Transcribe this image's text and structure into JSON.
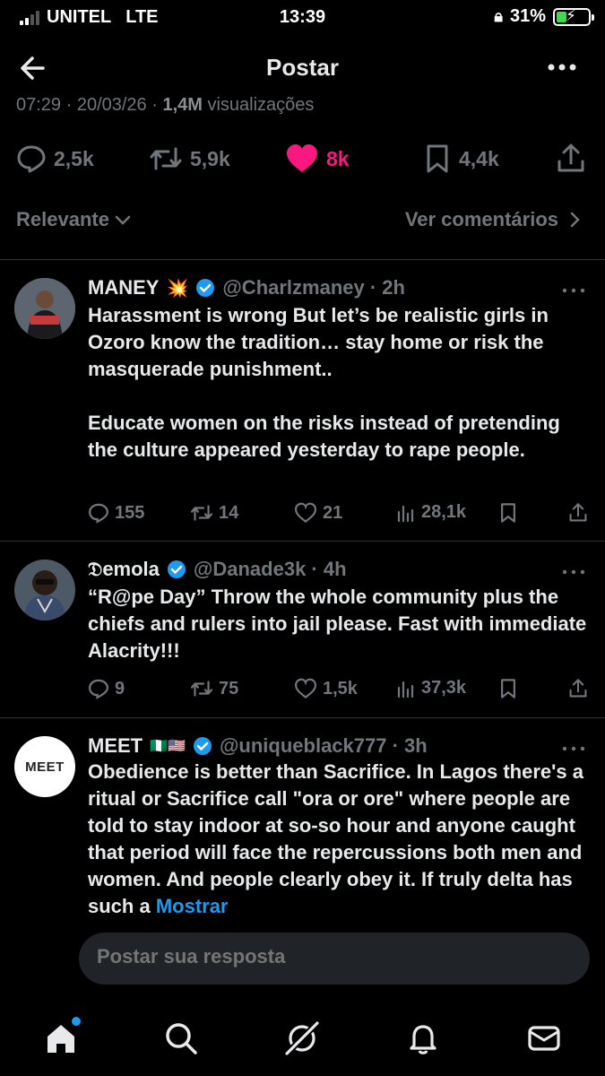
{
  "status_bar": {
    "carrier": "UNITEL",
    "network": "LTE",
    "time": "13:39",
    "battery": "31%"
  },
  "header": {
    "title": "Postar"
  },
  "post_meta": {
    "time_date": "07:29 · 20/03/26 · ",
    "views": "1,4M",
    "views_label": " visualizações"
  },
  "actions": {
    "replies": "2,5k",
    "reposts": "5,9k",
    "likes": "8k",
    "bookmarks": "4,4k",
    "like_color": "#f91880"
  },
  "sort": {
    "left_label": "Relevante",
    "right_label": "Ver comentários"
  },
  "replies": [
    {
      "name": "MANEY",
      "emoji": "💥",
      "handle": "@Charlzmaney · 2h",
      "text": "Harassment is wrong But let’s be realistic girls in Ozoro know the tradition… stay home or risk the masquerade punishment..\n\nEducate women on the risks instead of pretending the culture appeared yesterday to rape people.",
      "replies": "155",
      "reposts": "14",
      "likes": "21",
      "views": "28,1k"
    },
    {
      "name": "𝔇emola",
      "handle": "@Danade3k · 4h",
      "text": "“R@pe Day” Throw the whole community plus the chiefs and rulers into jail please. Fast with immediate Alacrity!!!",
      "replies": "9",
      "reposts": "75",
      "likes": "1,5k",
      "views": "37,3k"
    },
    {
      "name": "MEET",
      "flags": "🇳🇬🇺🇸",
      "handle": "@uniqueblack777 · 3h",
      "text": "Obedience is better than Sacrifice.   In Lagos there's a ritual or Sacrifice call \"ora or ore\" where people are told to stay indoor at so-so hour and anyone caught that period will face the repercussions both men and women. And people clearly obey it. If truly delta has such a ",
      "more": "Mostrar",
      "avatar_text": "MEET"
    }
  ],
  "composer": {
    "placeholder": "Postar sua resposta"
  },
  "colors": {
    "background": "#000000",
    "muted": "#71767b",
    "accent": "#1d9bf0",
    "like": "#f91880"
  }
}
